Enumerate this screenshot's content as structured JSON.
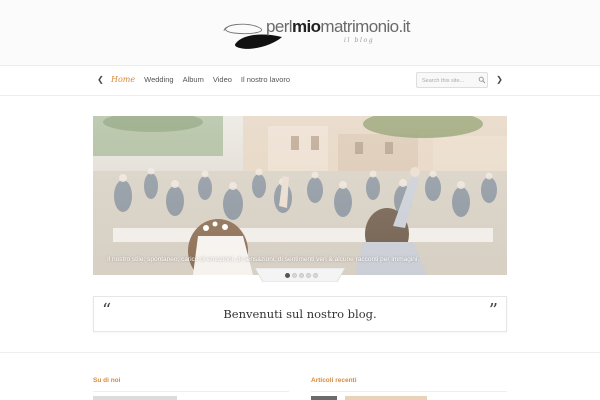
{
  "brand": {
    "name_prefix": "perilmio",
    "name_bold": "mio",
    "name_suffix": "matrimonio.it",
    "tagline": "il blog"
  },
  "nav": {
    "items": [
      {
        "label": "Home",
        "active": true
      },
      {
        "label": "Wedding",
        "active": false
      },
      {
        "label": "Album",
        "active": false
      },
      {
        "label": "Video",
        "active": false
      },
      {
        "label": "Il nostro lavoro",
        "active": false
      }
    ]
  },
  "search": {
    "placeholder": "Search this site...",
    "icon": "magnifier-icon"
  },
  "slider": {
    "caption": "Il nostro stile: spontaneo, carico di emozioni, di sensazioni, di sentimenti veri & alcune racconti per immagini.",
    "prev_icon": "chevron-left-icon",
    "next_icon": "chevron-right-icon",
    "slide_count": 5,
    "active_index": 0
  },
  "welcome": {
    "text": "Benvenuti sul nostro blog."
  },
  "footer_columns": {
    "about_title": "Su di noi",
    "recent_title": "Articoli recenti"
  },
  "colors": {
    "accent": "#d98a38",
    "text": "#333333",
    "border": "#e6e6e6"
  }
}
